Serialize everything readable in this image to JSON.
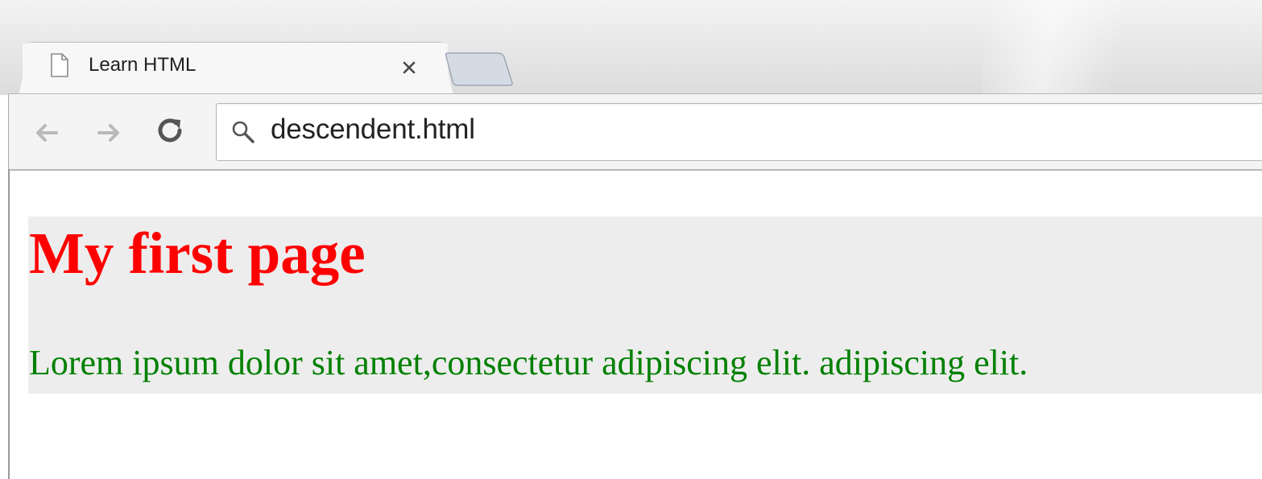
{
  "browser": {
    "tab": {
      "title": "Learn HTML",
      "icon": "page-icon",
      "close_icon": "close-icon"
    },
    "new_tab_icon": "new-tab-icon",
    "toolbar": {
      "back_icon": "back-arrow-icon",
      "forward_icon": "forward-arrow-icon",
      "reload_icon": "reload-icon",
      "omnibox": {
        "search_icon": "search-icon",
        "value": "descendent.html"
      }
    }
  },
  "page": {
    "heading": "My first page",
    "paragraph": "Lorem ipsum dolor sit amet,consectetur adipiscing elit. adipiscing elit.",
    "colors": {
      "heading": "#ff0000",
      "paragraph": "#008000",
      "container_background": "#ededed"
    }
  }
}
